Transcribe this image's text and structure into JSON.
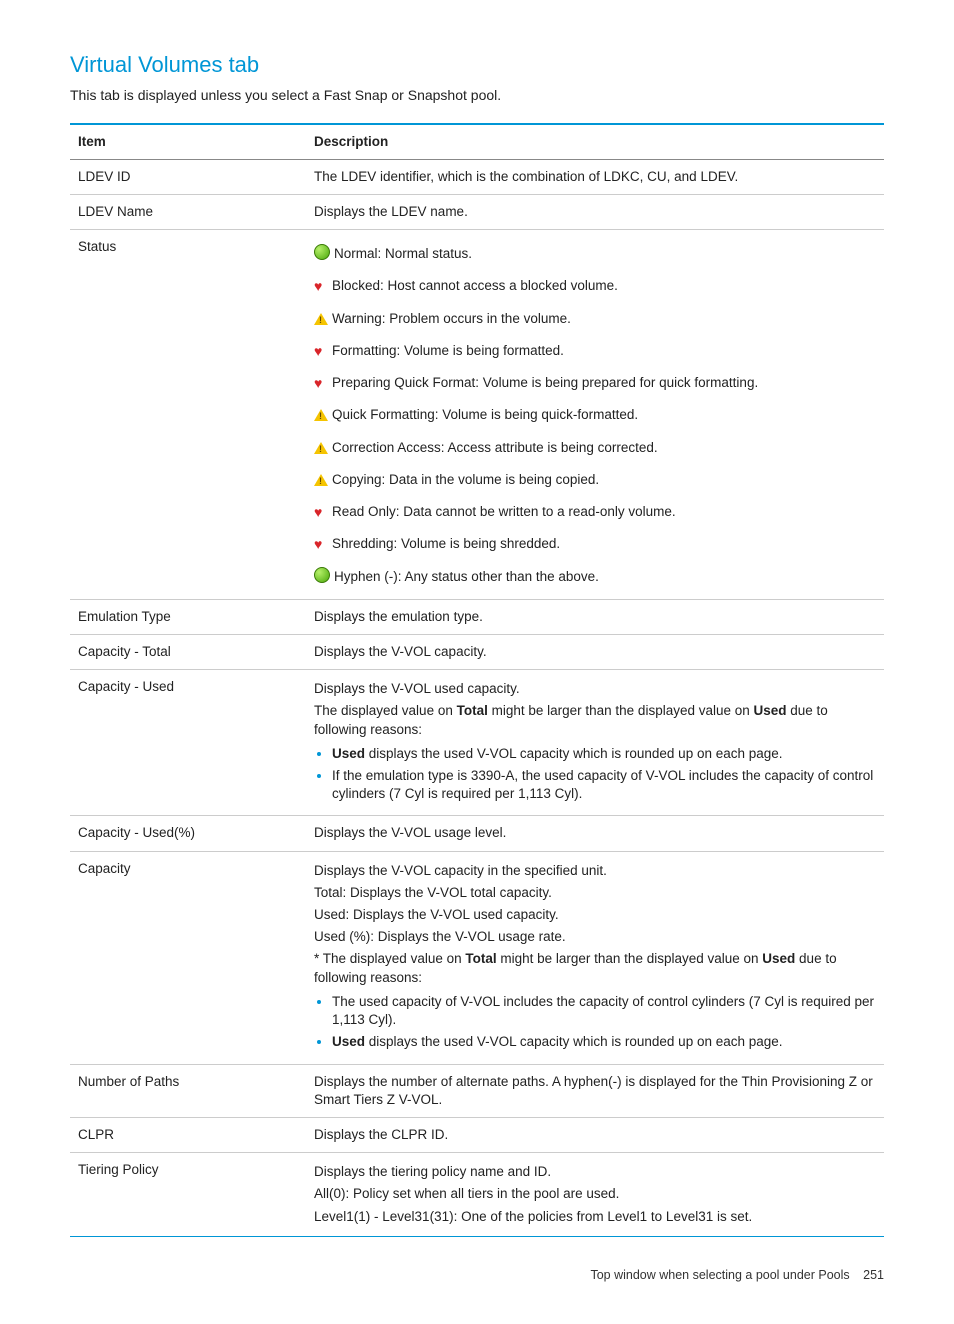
{
  "title": "Virtual Volumes tab",
  "lead": "This tab is displayed unless you select a Fast Snap or Snapshot pool.",
  "headers": {
    "item": "Item",
    "description": "Description"
  },
  "rows": {
    "ldev_id": {
      "item": "LDEV ID",
      "desc": "The LDEV identifier, which is the combination of LDKC, CU, and LDEV."
    },
    "ldev_name": {
      "item": "LDEV Name",
      "desc": "Displays the LDEV name."
    },
    "status": {
      "item": "Status",
      "normal": "Normal: Normal status.",
      "blocked": "Blocked: Host cannot access a blocked volume.",
      "warning": "Warning: Problem occurs in the volume.",
      "formatting": "Formatting: Volume is being formatted.",
      "preparing": "Preparing Quick Format: Volume is being prepared for quick formatting.",
      "quick_formatting": "Quick Formatting: Volume is being quick-formatted.",
      "correction": "Correction Access: Access attribute is being corrected.",
      "copying": "Copying: Data in the volume is being copied.",
      "readonly": "Read Only: Data cannot be written to a read-only volume.",
      "shredding": "Shredding: Volume is being shredded.",
      "hyphen": "Hyphen (-): Any status other than the above."
    },
    "emulation": {
      "item": "Emulation Type",
      "desc": "Displays the emulation type."
    },
    "cap_total": {
      "item": "Capacity - Total",
      "desc": "Displays the V-VOL capacity."
    },
    "cap_used": {
      "item": "Capacity - Used",
      "l1": "Displays the V-VOL used capacity.",
      "l2a": "The displayed value on ",
      "l2b": "Total",
      "l2c": " might be larger than the displayed value on ",
      "l2d": "Used",
      "l2e": " due to following reasons:",
      "b1a": "Used",
      "b1b": " displays the used V-VOL capacity which is rounded up on each page.",
      "b2": "If the emulation type is 3390-A, the used capacity of V-VOL includes the capacity of control cylinders (7 Cyl is required per 1,113 Cyl)."
    },
    "cap_used_pct": {
      "item": "Capacity - Used(%)",
      "desc": "Displays the V-VOL usage level."
    },
    "capacity": {
      "item": "Capacity",
      "l1": "Displays the V-VOL capacity in the specified unit.",
      "l2": "Total: Displays the V-VOL total capacity.",
      "l3": "Used: Displays the V-VOL used capacity.",
      "l4": "Used (%): Displays the V-VOL usage rate.",
      "l5a": "* The displayed value on ",
      "l5b": "Total",
      "l5c": " might be larger than the displayed value on ",
      "l5d": "Used",
      "l5e": " due to following reasons:",
      "b1": "The used capacity of V-VOL includes the capacity of control cylinders (7 Cyl is required per 1,113 Cyl).",
      "b2a": "Used",
      "b2b": " displays the used V-VOL capacity which is rounded up on each page."
    },
    "paths": {
      "item": "Number of Paths",
      "desc": "Displays the number of alternate paths. A hyphen(-) is displayed for the Thin Provisioning Z or Smart Tiers Z V-VOL."
    },
    "clpr": {
      "item": "CLPR",
      "desc": "Displays the CLPR ID."
    },
    "tiering": {
      "item": "Tiering Policy",
      "l1": "Displays the tiering policy name and ID.",
      "l2": "All(0): Policy set when all tiers in the pool are used.",
      "l3": "Level1(1) - Level31(31): One of the policies from Level1 to Level31 is set."
    }
  },
  "footer": {
    "text": "Top window when selecting a pool under Pools",
    "page": "251"
  }
}
